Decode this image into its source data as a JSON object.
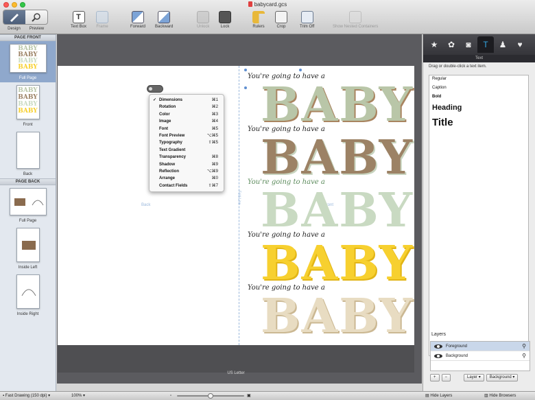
{
  "window": {
    "title": "babycard.gcs"
  },
  "toolbar": {
    "design": "Design",
    "preview": "Preview",
    "text_box": "Text Box",
    "tool2": "Frame",
    "forward": "Forward",
    "backward": "Backward",
    "unlock": "Unlock",
    "lock": "Lock",
    "rulers": "Rulers",
    "crop": "Crop",
    "trim_off": "Trim Off",
    "show_nested": "Show Nested Containers"
  },
  "sidebar": {
    "page_front_header": "PAGE FRONT",
    "page_back_header": "PAGE BACK",
    "front_items": [
      "Full Page",
      "Front",
      "Back"
    ],
    "back_items": [
      "Full Page",
      "Inside Left",
      "Inside Right"
    ]
  },
  "canvas": {
    "line_text": "You're going to have a",
    "baby_text": "BABY",
    "back_guide": "Back",
    "front_guide": "Front",
    "fold_guide": "Fold Line",
    "paper_size": "US Letter"
  },
  "context_menu": {
    "items": [
      {
        "label": "Dimensions",
        "shortcut": "⌘1",
        "checked": "✓"
      },
      {
        "label": "Rotation",
        "shortcut": "⌘2",
        "checked": ""
      },
      {
        "label": "Color",
        "shortcut": "⌘3",
        "checked": ""
      },
      {
        "label": "Image",
        "shortcut": "⌘4",
        "checked": ""
      },
      {
        "label": "Font",
        "shortcut": "⌘5",
        "checked": ""
      },
      {
        "label": "Font Preview",
        "shortcut": "⌥⌘5",
        "checked": ""
      },
      {
        "label": "Typography",
        "shortcut": "⇧⌘5",
        "checked": ""
      },
      {
        "label": "Text Gradient",
        "shortcut": "",
        "checked": ""
      },
      {
        "label": "Transparency",
        "shortcut": "⌘8",
        "checked": ""
      },
      {
        "label": "Shadow",
        "shortcut": "⌘9",
        "checked": ""
      },
      {
        "label": "Reflection",
        "shortcut": "⌥⌘9",
        "checked": ""
      },
      {
        "label": "Arrange",
        "shortcut": "⌘0",
        "checked": ""
      },
      {
        "label": "Contact Fields",
        "shortcut": "⇧⌘7",
        "checked": ""
      }
    ]
  },
  "inspector": {
    "tabs": [
      "★",
      "✿",
      "◙",
      "T",
      "♟",
      "♥"
    ],
    "panel_title": "Text",
    "hint": "Drag or double-click a text item.",
    "styles": [
      "Regular",
      "Caption",
      "Bold",
      "Heading",
      "Title"
    ],
    "layers_header": "Layers",
    "layers": [
      "Foreground",
      "Background"
    ],
    "add": "+",
    "remove": "−",
    "layer_popup": "Layer",
    "background_popup": "Background"
  },
  "statusbar": {
    "quality": "Fast Drawing (150 dpi)",
    "zoom": "100%",
    "zoom_level": 0.5,
    "hide_layers": "Hide Layers",
    "hide_browsers": "Hide Browsers"
  },
  "colors": {
    "yellow": "#f7d02f",
    "sage": "#c9dac2",
    "brown": "#9c8265",
    "selection_blue": "#8fa8cc",
    "accent_blue": "#34a9e6"
  }
}
